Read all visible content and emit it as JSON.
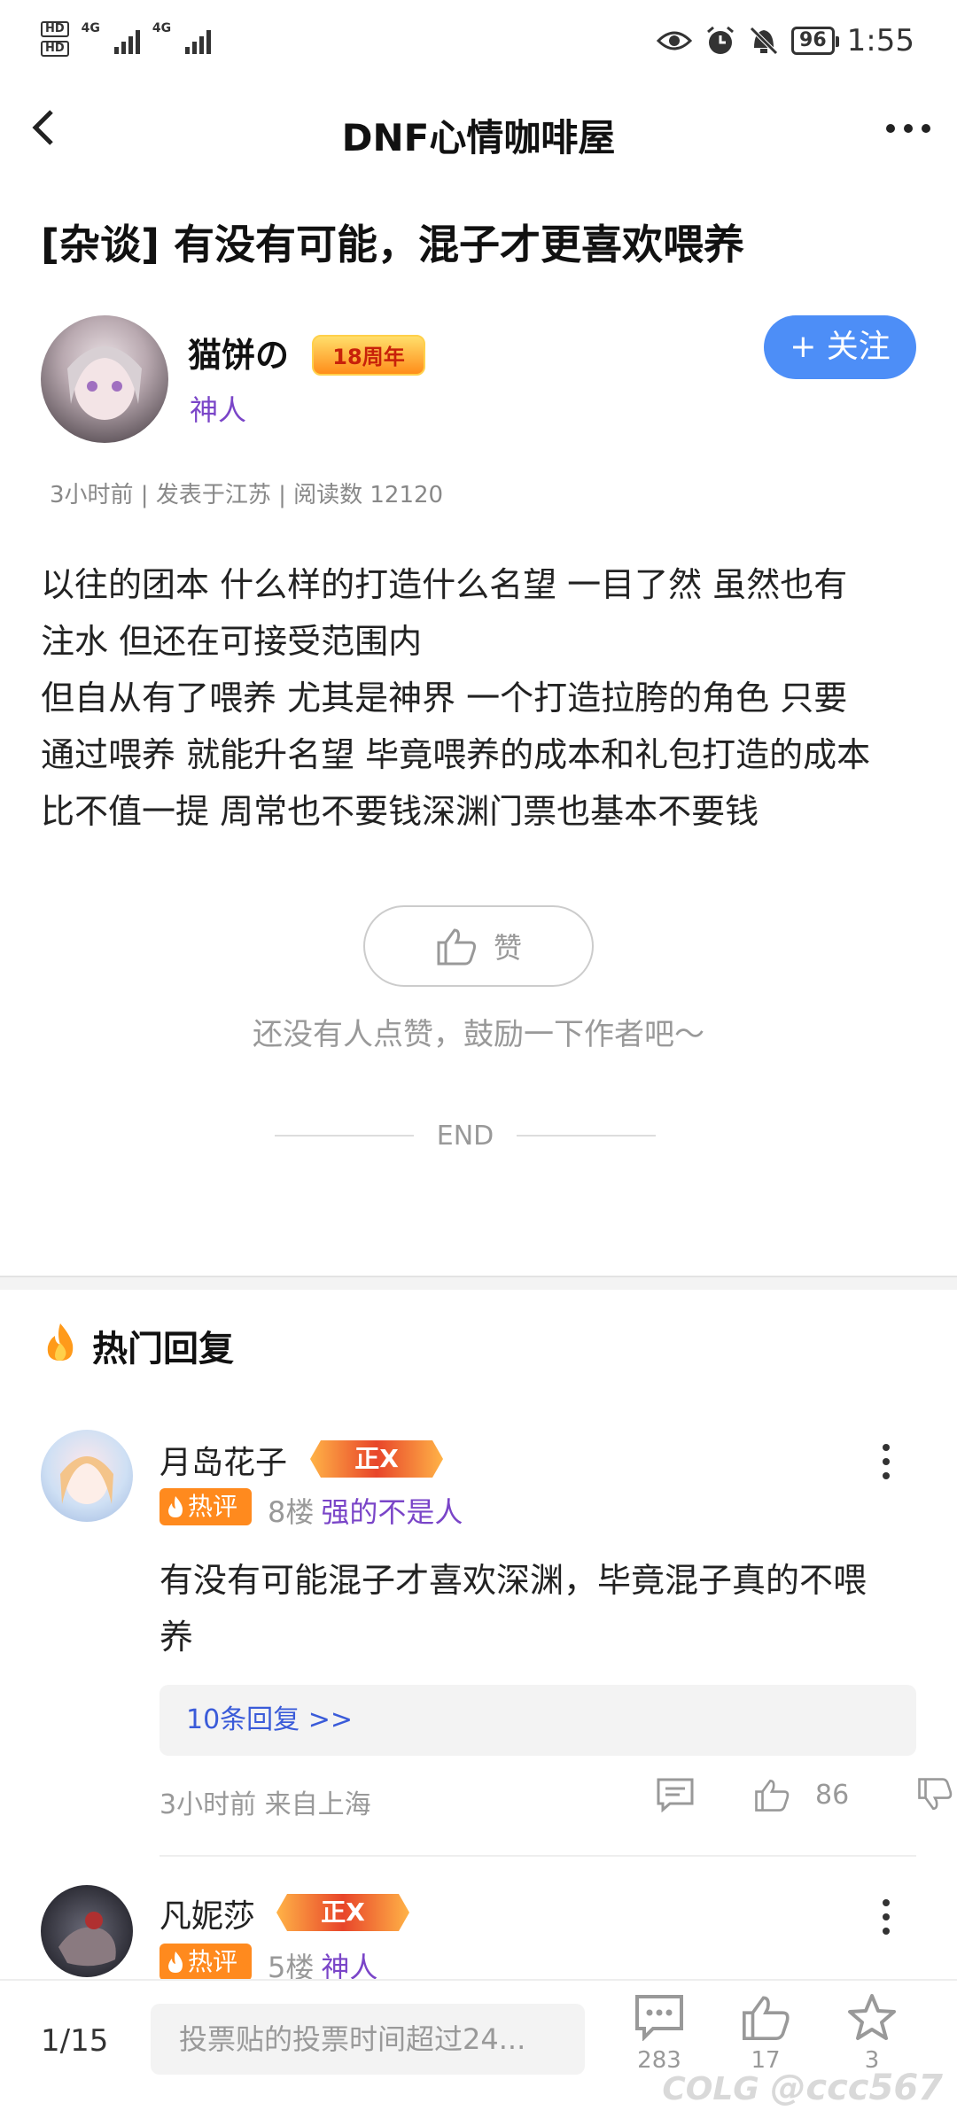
{
  "status_bar": {
    "network1": "4G",
    "network2": "4G",
    "battery": "96",
    "time": "1:55",
    "icons": [
      "eye-icon",
      "alarm-icon",
      "mute-icon"
    ]
  },
  "nav": {
    "title": "DNF心情咖啡屋",
    "back_icon": "chevron-left-icon",
    "more_icon": "more-dots-icon"
  },
  "post": {
    "title": "[杂谈] 有没有可能，混子才更喜欢喂养",
    "author": {
      "name": "猫饼の",
      "anniversary_badge": "18周年",
      "title": "神人",
      "follow_label": "+ 关注"
    },
    "meta": "3小时前 | 发表于江苏 | 阅读数 12120",
    "content_lines": [
      "以往的团本 什么样的打造什么名望 一目了然 虽然也有",
      "注水 但还在可接受范围内",
      "但自从有了喂养 尤其是神界 一个打造拉胯的角色 只要",
      "通过喂养 就能升名望 毕竟喂养的成本和礼包打造的成本",
      "比不值一提 周常也不要钱深渊门票也基本不要钱"
    ],
    "like_label": "赞",
    "like_hint": "还没有人点赞，鼓励一下作者吧～",
    "end_label": "END"
  },
  "hot_replies": {
    "title": "热门回复",
    "comments": [
      {
        "name": "月岛花子",
        "level_badge": "正X",
        "hot_label": "热评",
        "floor": "8楼",
        "user_title": "强的不是人",
        "text_lines": [
          "有没有可能混子才喜欢深渊，毕竟混子真的不喂",
          "养"
        ],
        "replies_label": "10条回复 >>",
        "time": "3小时前 来自上海",
        "likes": "86"
      },
      {
        "name": "凡妮莎",
        "level_badge": "正X",
        "hot_label": "热评",
        "floor": "5楼",
        "user_title": "神人"
      }
    ]
  },
  "bottom_bar": {
    "page": "1/15",
    "input_placeholder": "投票贴的投票时间超过24...",
    "comments_count": "283",
    "likes_count": "17",
    "favorites_count": "3"
  },
  "watermark": "@ccc567",
  "colors": {
    "accent": "#4d8ef7",
    "title_purple": "#7a45c8",
    "hot_orange": "#ff8a1e",
    "link_blue": "#3a5bd9"
  }
}
